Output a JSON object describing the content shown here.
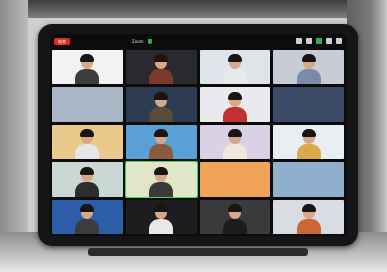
{
  "toolbar": {
    "end_label": "结束",
    "meeting_title": "Zoom"
  },
  "tiles": [
    {
      "name": "",
      "bg": "#f2f2f2",
      "shirt": "#3d3d3d",
      "person": true
    },
    {
      "name": "",
      "bg": "#2a2a2e",
      "shirt": "#7a3a2e",
      "person": true
    },
    {
      "name": "",
      "bg": "#dfe3ea",
      "shirt": "#e9e9e9",
      "person": true
    },
    {
      "name": "",
      "bg": "#c8ccd6",
      "shirt": "#7a8aa8",
      "person": true
    },
    {
      "name": "",
      "bg": "#a9b7c6",
      "shirt": "#5a5a5a",
      "person": false
    },
    {
      "name": "",
      "bg": "#2d3b52",
      "shirt": "#5a4a3a",
      "person": true
    },
    {
      "name": "",
      "bg": "#e8eaee",
      "shirt": "#c23030",
      "person": true
    },
    {
      "name": "",
      "bg": "#3a4a66",
      "shirt": "#2a2a2a",
      "person": false
    },
    {
      "name": "",
      "bg": "#e9c98c",
      "shirt": "#e6e6e6",
      "person": true
    },
    {
      "name": "",
      "bg": "#5aa0d8",
      "shirt": "#8c5a3c",
      "person": true
    },
    {
      "name": "",
      "bg": "#d9d2e6",
      "shirt": "#f1e7da",
      "person": true
    },
    {
      "name": "",
      "bg": "#e9eef2",
      "shirt": "#d9a94a",
      "person": true
    },
    {
      "name": "",
      "bg": "#c9d8d4",
      "shirt": "#2d2d2d",
      "person": true
    },
    {
      "name": "",
      "bg": "#e0e6c8",
      "shirt": "#3a3a3a",
      "person": true,
      "active": true
    },
    {
      "name": "",
      "bg": "#f0a45a",
      "shirt": "#3a3a3a",
      "person": false
    },
    {
      "name": "",
      "bg": "#8fb0cc",
      "shirt": "#ffffff",
      "person": false
    },
    {
      "name": "",
      "bg": "#2b5ea6",
      "shirt": "#3c3c3c",
      "person": true
    },
    {
      "name": "",
      "bg": "#1d1d1f",
      "shirt": "#e8e8e8",
      "person": true
    },
    {
      "name": "",
      "bg": "#3a3a3c",
      "shirt": "#1d1d1d",
      "person": true
    },
    {
      "name": "",
      "bg": "#d9dde3",
      "shirt": "#cc6633",
      "person": true
    }
  ],
  "colors": {
    "end_button": "#d92d2a",
    "active_border": "#43d15e",
    "shield": "#2bb34a"
  }
}
